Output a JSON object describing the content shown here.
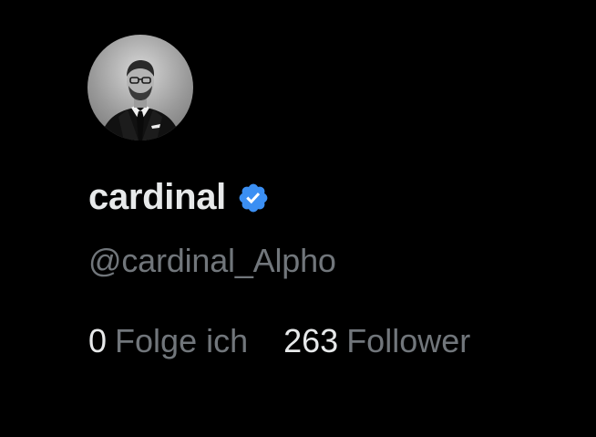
{
  "profile": {
    "display_name": "cardinal",
    "handle": "@cardinal_Alpho",
    "verified": true,
    "verified_color": "#3b8ff3",
    "avatar_icon": "avatar-photo-man-in-suit-grayscale"
  },
  "stats": {
    "following": {
      "count": "0",
      "label": "Folge ich"
    },
    "followers": {
      "count": "263",
      "label": "Follower"
    }
  },
  "colors": {
    "background": "#000000",
    "primary_text": "#e7e9ea",
    "secondary_text": "#71767b"
  }
}
